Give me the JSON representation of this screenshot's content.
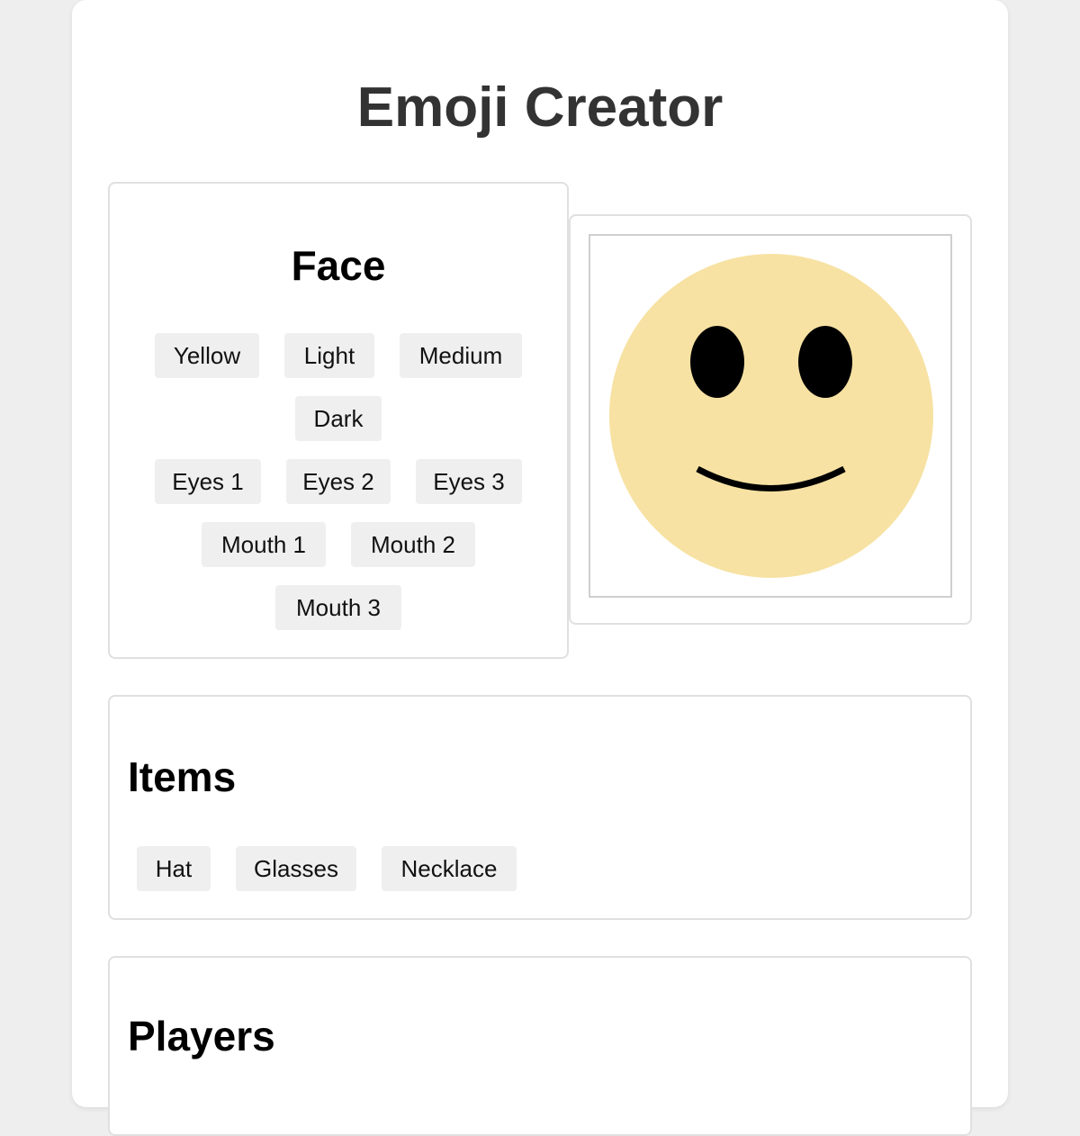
{
  "app": {
    "title": "Emoji Creator"
  },
  "face_panel": {
    "title": "Face",
    "buttons": [
      "Yellow",
      "Light",
      "Medium",
      "Dark",
      "Eyes 1",
      "Eyes 2",
      "Eyes 3",
      "Mouth 1",
      "Mouth 2",
      "Mouth 3"
    ]
  },
  "preview": {
    "face_color": "#f7e2a3",
    "feature_color": "#000000"
  },
  "items_panel": {
    "title": "Items",
    "buttons": [
      "Hat",
      "Glasses",
      "Necklace"
    ]
  },
  "players_panel": {
    "title": "Players"
  }
}
